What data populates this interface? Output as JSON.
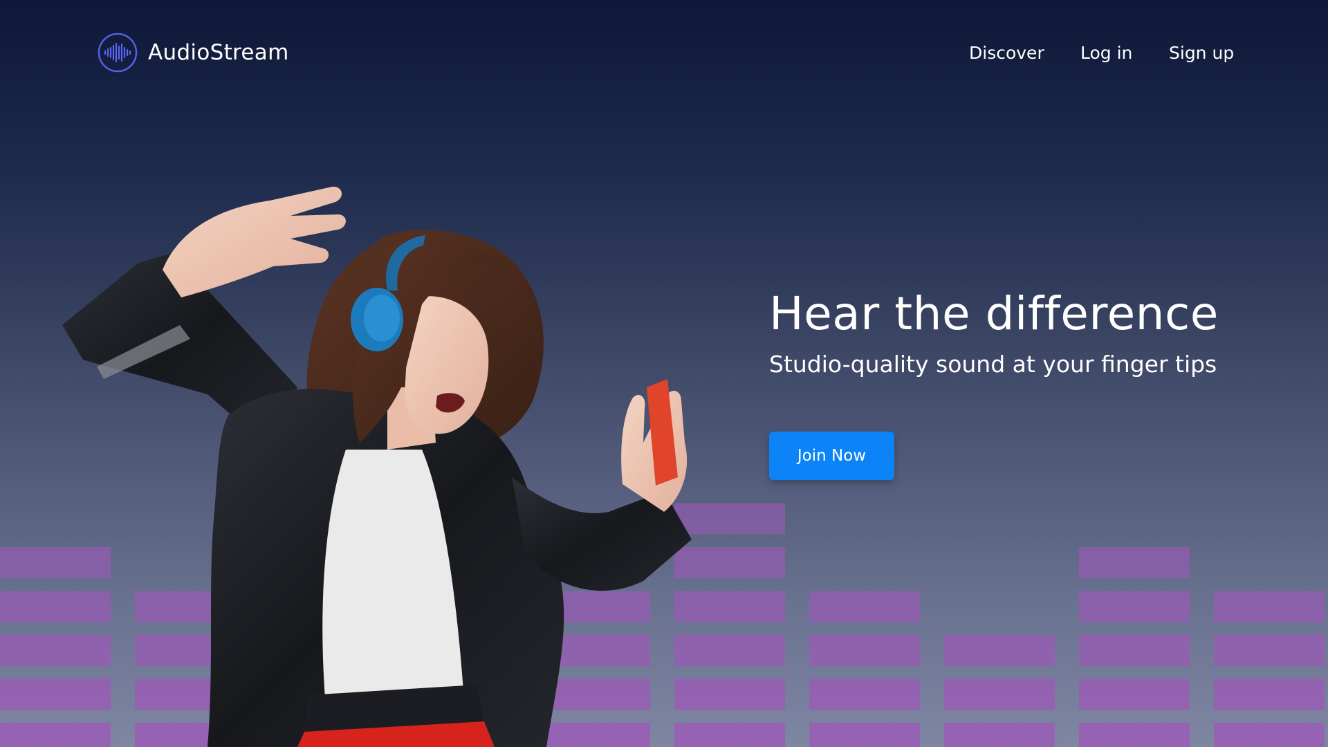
{
  "brand": {
    "name": "AudioStream",
    "logo_icon": "soundwave-logo-icon",
    "logo_ring_color": "#5560e8",
    "logo_wave_color": "#5a64f0"
  },
  "nav": {
    "discover": "Discover",
    "login": "Log in",
    "signup": "Sign up"
  },
  "hero": {
    "title": "Hear the difference",
    "subtitle": "Studio-quality sound at your finger tips",
    "cta_label": "Join Now",
    "image": "woman-dancing-with-headphones"
  },
  "colors": {
    "background_top": "#0e1838",
    "background_bottom": "#7e86a2",
    "equalizer_bar": "#9d58b8",
    "cta_background": "#0c83f6",
    "text": "#ffffff"
  },
  "equalizer": {
    "column_levels": [
      5,
      4,
      3,
      4,
      5,
      6,
      4,
      3,
      5,
      4
    ]
  }
}
